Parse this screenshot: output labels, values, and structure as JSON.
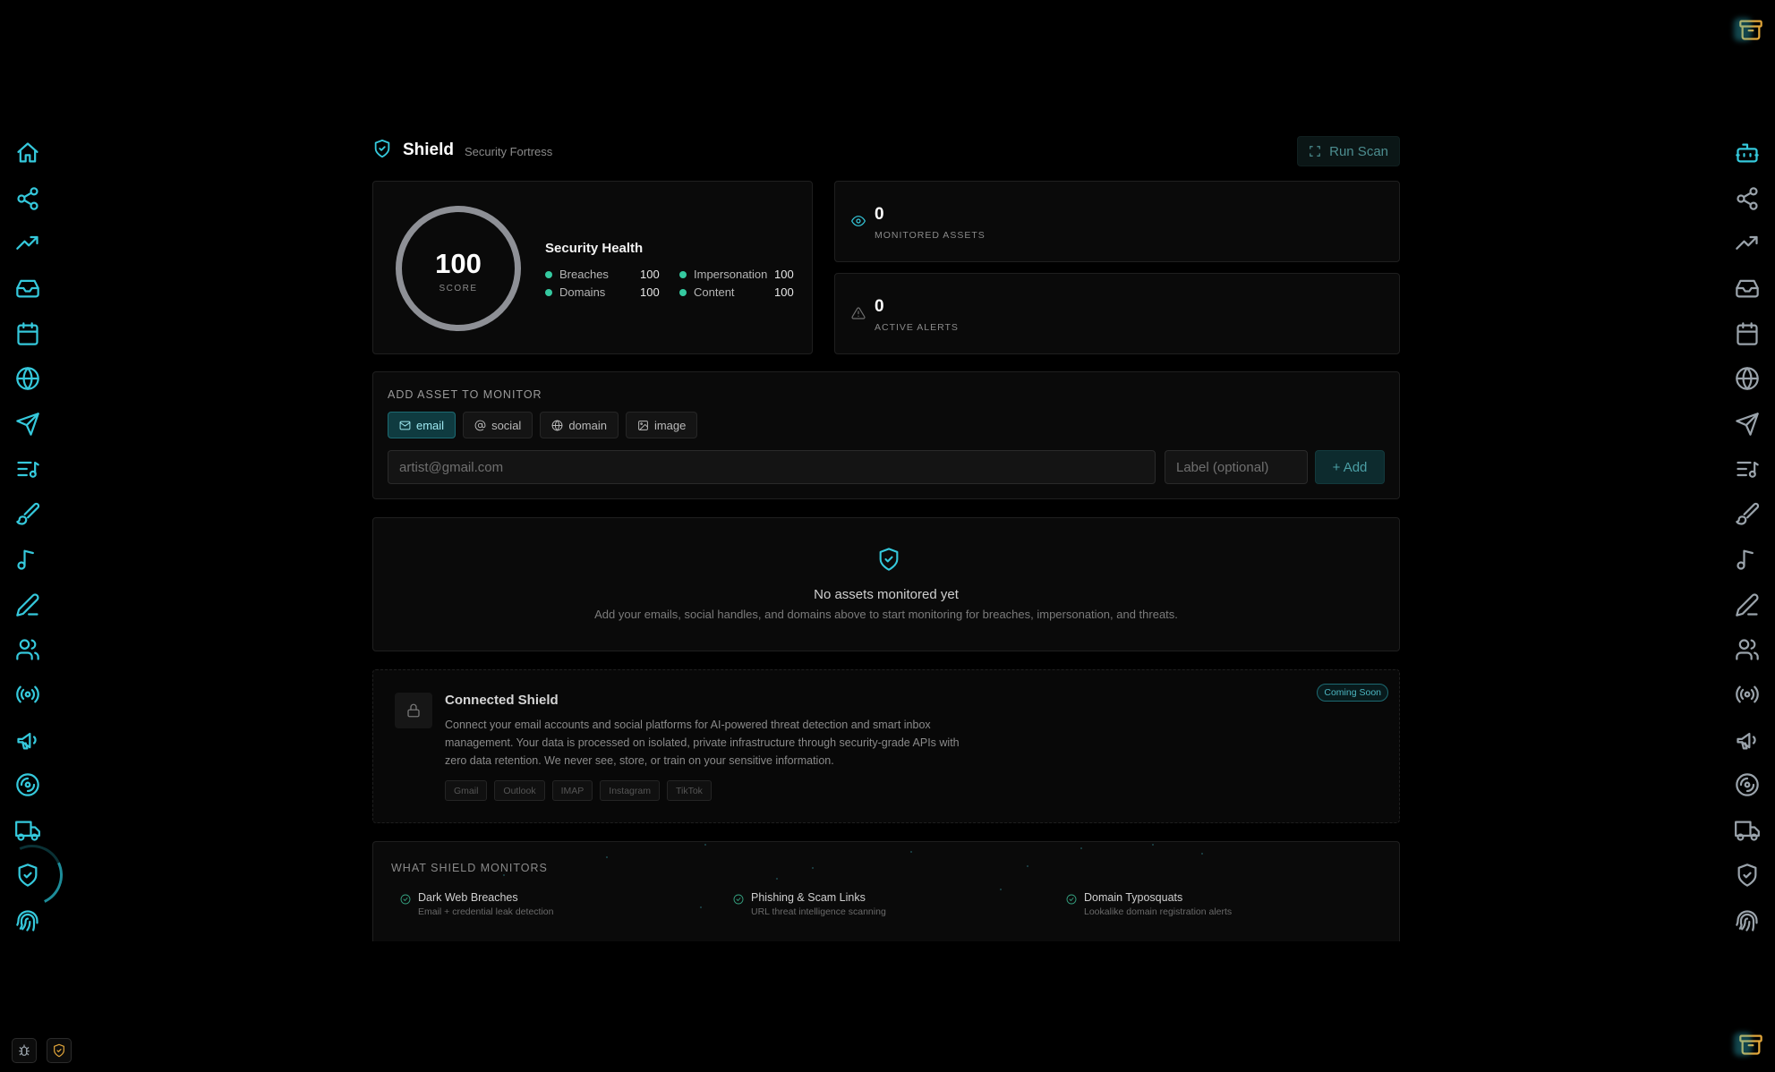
{
  "header": {
    "title": "Shield",
    "subtitle": "Security Fortress",
    "run_scan_label": "Run Scan"
  },
  "health": {
    "score": "100",
    "score_label": "SCORE",
    "title": "Security Health",
    "metrics": [
      {
        "label": "Breaches",
        "value": "100"
      },
      {
        "label": "Impersonation",
        "value": "100"
      },
      {
        "label": "Domains",
        "value": "100"
      },
      {
        "label": "Content",
        "value": "100"
      }
    ]
  },
  "stats": {
    "monitored": {
      "value": "0",
      "label": "MONITORED ASSETS"
    },
    "alerts": {
      "value": "0",
      "label": "ACTIVE ALERTS"
    }
  },
  "add_asset": {
    "section_label": "ADD ASSET TO MONITOR",
    "tabs": [
      {
        "label": "email",
        "icon": "mail-icon",
        "selected": true
      },
      {
        "label": "social",
        "icon": "at-icon",
        "selected": false
      },
      {
        "label": "domain",
        "icon": "globe-icon",
        "selected": false
      },
      {
        "label": "image",
        "icon": "image-icon",
        "selected": false
      }
    ],
    "value_placeholder": "artist@gmail.com",
    "label_placeholder": "Label (optional)",
    "add_label": "+ Add"
  },
  "empty_state": {
    "title": "No assets monitored yet",
    "description": "Add your emails, social handles, and domains above to start monitoring for breaches, impersonation, and threats."
  },
  "connected": {
    "title": "Connected Shield",
    "badge": "Coming Soon",
    "description": "Connect your email accounts and social platforms for AI-powered threat detection and smart inbox management. Your data is processed on isolated, private infrastructure through security-grade APIs with zero data retention. We never see, store, or train on your sensitive information.",
    "chips": [
      "Gmail",
      "Outlook",
      "IMAP",
      "Instagram",
      "TikTok"
    ]
  },
  "monitors": {
    "section_label": "WHAT SHIELD MONITORS",
    "items": [
      {
        "title": "Dark Web Breaches",
        "desc": "Email + credential leak detection"
      },
      {
        "title": "Phishing & Scam Links",
        "desc": "URL threat intelligence scanning"
      },
      {
        "title": "Domain Typosquats",
        "desc": "Lookalike domain registration alerts"
      }
    ]
  },
  "left_nav": [
    "home-icon",
    "share-icon",
    "trending-icon",
    "inbox-icon",
    "calendar-icon",
    "globe-icon",
    "send-icon",
    "playlist-icon",
    "brush-icon",
    "music-icon",
    "pen-icon",
    "users-icon",
    "radio-icon",
    "megaphone-icon",
    "disc-icon",
    "truck-icon",
    "shield-icon",
    "fingerprint-icon"
  ],
  "right_nav": [
    "bot-icon",
    "share-icon",
    "trending-icon",
    "inbox-icon",
    "calendar-icon",
    "globe-icon",
    "send-icon",
    "playlist-icon",
    "brush-icon",
    "music-icon",
    "pen-icon",
    "users-icon",
    "radio-icon",
    "megaphone-icon",
    "disc-icon",
    "truck-icon",
    "shield-icon",
    "fingerprint-icon"
  ],
  "colors": {
    "accent": "#35c9dc",
    "status_ok": "#35c9a0",
    "archive": "#e2a63a",
    "background": "#000000"
  }
}
